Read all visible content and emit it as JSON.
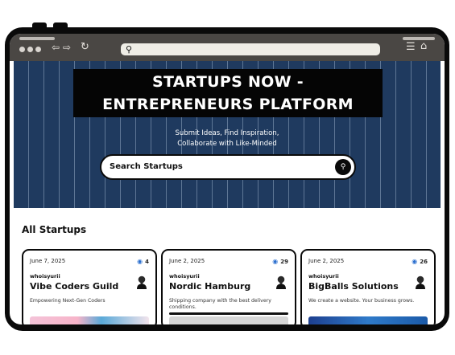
{
  "hero": {
    "title_line1": "STARTUPS NOW -",
    "title_line2": "ENTREPRENEURS PLATFORM",
    "subtitle_line1": "Submit Ideas, Find Inspiration,",
    "subtitle_line2": "Collaborate with Like-Minded",
    "search_placeholder": "Search Startups"
  },
  "section": {
    "title": "All Startups"
  },
  "cards": [
    {
      "date": "June 7, 2025",
      "views": "4",
      "author": "whoisyurii",
      "name": "Vibe Coders Guild",
      "description": "Empowering Next-Gen Coders"
    },
    {
      "date": "June 2, 2025",
      "views": "29",
      "author": "whoisyurii",
      "name": "Nordic Hamburg",
      "description": "Shipping company with the best delivery conditions."
    },
    {
      "date": "June 2, 2025",
      "views": "26",
      "author": "whoisyurii",
      "name": "BigBalls Solutions",
      "description": "We create a website. Your business grows."
    }
  ],
  "icons": {
    "back": "arrow-left-icon",
    "forward": "arrow-right-icon",
    "reload": "reload-icon",
    "search": "search-icon",
    "menu": "hamburger-menu-icon",
    "home": "home-icon",
    "views": "eye-icon"
  },
  "colors": {
    "hero_background": "#1f3a5f",
    "frame": "#0a0a0a",
    "toolbar": "#4a4744",
    "views_icon": "#2b6fcf"
  }
}
